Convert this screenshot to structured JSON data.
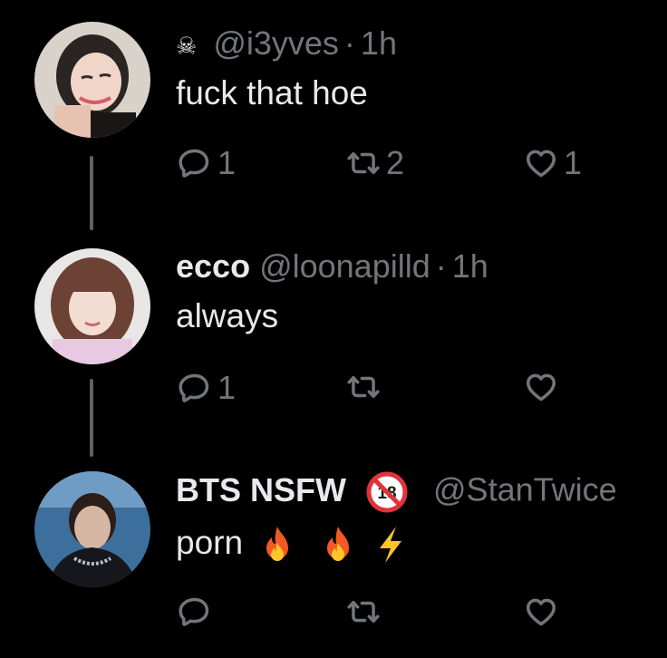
{
  "tweets": [
    {
      "emoji_prefix": "☠",
      "display_name": "",
      "handle": "@i3yves",
      "time": "1h",
      "text": "fuck that hoe",
      "reply_count": "1",
      "retweet_count": "2",
      "like_count": "1"
    },
    {
      "display_name": "ecco",
      "handle": "@loonapilld",
      "time": "1h",
      "text": "always",
      "reply_count": "1",
      "retweet_count": "",
      "like_count": ""
    },
    {
      "display_name": "BTS NSFW",
      "badge": "18",
      "handle": "@StanTwice",
      "time": "",
      "text": "porn",
      "text_emojis": [
        "fire",
        "fire",
        "lightning"
      ],
      "reply_count": "",
      "retweet_count": "",
      "like_count": ""
    }
  ],
  "icons": {
    "reply": "reply-icon",
    "retweet": "retweet-icon",
    "like": "heart-icon",
    "skull": "skull-crossbones-icon",
    "fire": "fire-emoji-icon",
    "lightning": "lightning-emoji-icon",
    "no_under_18": "no-under-18-icon"
  },
  "colors": {
    "background": "#000000",
    "text": "#e7e9ea",
    "muted": "#71767b",
    "thread_line": "#5b6166"
  }
}
